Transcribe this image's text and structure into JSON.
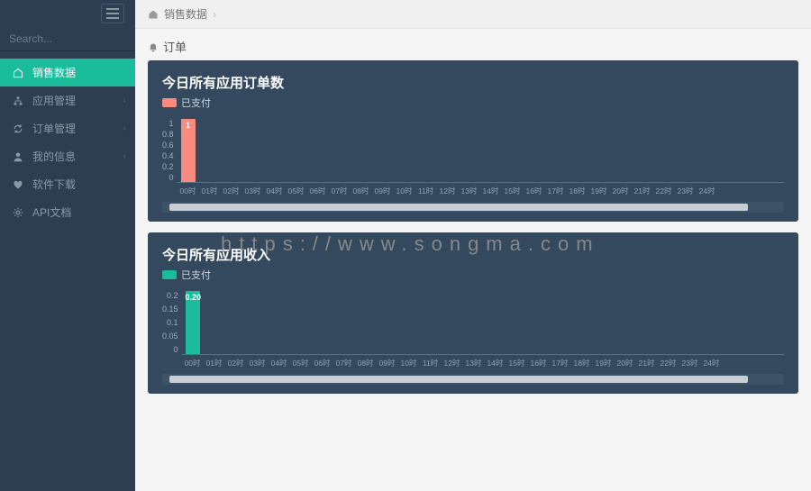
{
  "sidebar": {
    "search_placeholder": "Search...",
    "items": [
      {
        "label": "销售数据",
        "active": true,
        "icon": "home",
        "expandable": false
      },
      {
        "label": "应用管理",
        "active": false,
        "icon": "sitemap",
        "expandable": true
      },
      {
        "label": "订单管理",
        "active": false,
        "icon": "refresh",
        "expandable": true
      },
      {
        "label": "我的信息",
        "active": false,
        "icon": "user",
        "expandable": true
      },
      {
        "label": "软件下载",
        "active": false,
        "icon": "heart",
        "expandable": false
      },
      {
        "label": "API文档",
        "active": false,
        "icon": "gear",
        "expandable": false
      }
    ]
  },
  "breadcrumb": {
    "root": "销售数据"
  },
  "section": {
    "title": "订单"
  },
  "watermark": "https://www.songma.com",
  "colors": {
    "accent": "#1abc9c",
    "panel_bg": "#34495e",
    "series_orders": "#f78b7d",
    "series_revenue": "#1abc9c"
  },
  "chart_data": [
    {
      "type": "bar",
      "title": "今日所有应用订单数",
      "legend": "已支付",
      "color": "#f78b7d",
      "categories": [
        "00时",
        "01时",
        "02时",
        "03时",
        "04时",
        "05时",
        "06时",
        "07时",
        "08时",
        "09时",
        "10时",
        "11时",
        "12时",
        "13时",
        "14时",
        "15时",
        "16时",
        "17时",
        "18时",
        "19时",
        "20时",
        "21时",
        "22时",
        "23时",
        "24时"
      ],
      "y_ticks": [
        "1",
        "0.8",
        "0.6",
        "0.4",
        "0.2",
        "0"
      ],
      "ylim": [
        0,
        1
      ],
      "series": [
        {
          "name": "已支付",
          "values": [
            1,
            0,
            0,
            0,
            0,
            0,
            0,
            0,
            0,
            0,
            0,
            0,
            0,
            0,
            0,
            0,
            0,
            0,
            0,
            0,
            0,
            0,
            0,
            0,
            0
          ]
        }
      ],
      "value_labels": [
        "1"
      ]
    },
    {
      "type": "bar",
      "title": "今日所有应用收入",
      "legend": "已支付",
      "color": "#1abc9c",
      "categories": [
        "00时",
        "01时",
        "02时",
        "03时",
        "04时",
        "05时",
        "06时",
        "07时",
        "08时",
        "09时",
        "10时",
        "11时",
        "12时",
        "13时",
        "14时",
        "15时",
        "16时",
        "17时",
        "18时",
        "19时",
        "20时",
        "21时",
        "22时",
        "23时",
        "24时"
      ],
      "y_ticks": [
        "0.2",
        "0.15",
        "0.1",
        "0.05",
        "0"
      ],
      "ylim": [
        0,
        0.2
      ],
      "series": [
        {
          "name": "已支付",
          "values": [
            0.2,
            0,
            0,
            0,
            0,
            0,
            0,
            0,
            0,
            0,
            0,
            0,
            0,
            0,
            0,
            0,
            0,
            0,
            0,
            0,
            0,
            0,
            0,
            0,
            0
          ]
        }
      ],
      "value_labels": [
        "0.20"
      ]
    }
  ]
}
